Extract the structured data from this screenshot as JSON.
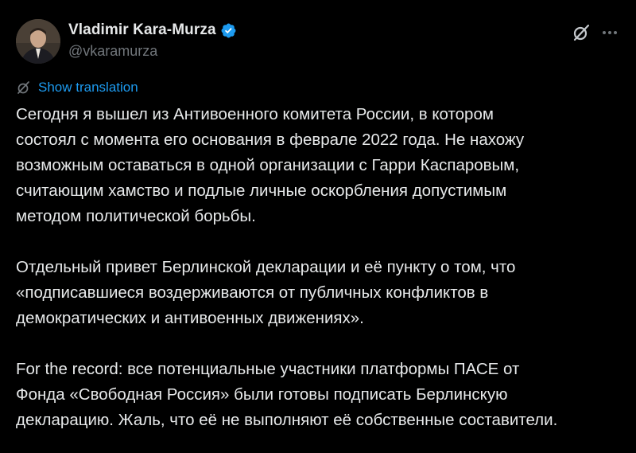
{
  "author": {
    "display_name": "Vladimir Kara-Murza",
    "handle": "@vkaramurza",
    "verified": true,
    "verified_color": "#1d9bf0"
  },
  "actions": {
    "grok_icon": "grok-icon",
    "more_icon": "more-icon"
  },
  "translate": {
    "label": "Show translation",
    "icon": "translate-icon",
    "color": "#1d9bf0"
  },
  "tweet": {
    "paragraphs": [
      [
        "Сегодня я вышел из Антивоенного комитета России, в котором",
        "состоял с момента его основания в феврале 2022 года. Не нахожу",
        "возможным оставаться в одной организации с Гарри Каспаровым,",
        "считающим хамство и подлые личные оскорбления допустимым",
        "методом политической борьбы."
      ],
      [
        "Отдельный привет Берлинской декларации и её пункту о том, что",
        "«подписавшиеся воздерживаются от публичных конфликтов в",
        "демократических и антивоенных движениях»."
      ],
      [
        "For the record: все потенциальные участники платформы ПАСЕ от",
        "Фонда «Свободная Россия» были готовы подписать Берлинскую",
        "декларацию. Жаль, что её не выполняют её собственные составители."
      ]
    ]
  },
  "colors": {
    "background": "#000000",
    "text": "#e7e9ea",
    "secondary": "#71767b",
    "accent": "#1d9bf0"
  }
}
